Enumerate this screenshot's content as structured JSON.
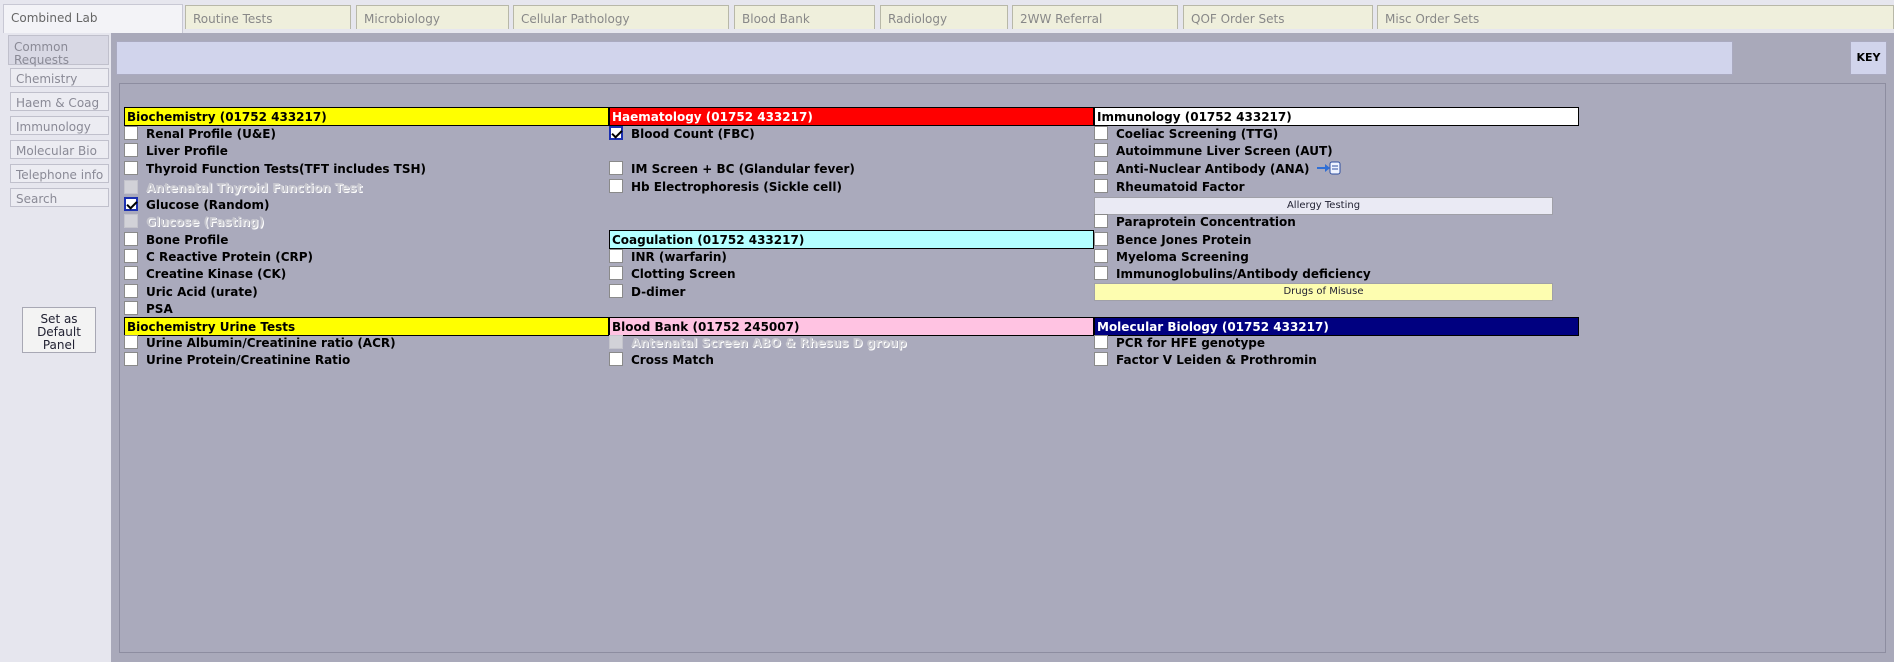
{
  "tabs": [
    "Combined Lab",
    "Routine Tests",
    "Microbiology",
    "Cellular Pathology",
    "Blood Bank",
    "Radiology",
    "2WW Referral",
    "QOF Order Sets",
    "Misc Order Sets"
  ],
  "sidebar": {
    "items": [
      "Common Requests",
      "Chemistry",
      "Haem & Coag",
      "Immunology",
      "Molecular Bio",
      "Telephone info",
      "Search"
    ],
    "set_default_label": "Set as Default Panel"
  },
  "key_label": "KEY",
  "colors": {
    "biochemistry": "#ffff00",
    "haematology": "#ff0000",
    "immunology": "#ffffff",
    "coagulation": "#b3ffff",
    "blood_bank": "#ffc3e2",
    "molecular_biology": "#000080",
    "checkbox_checked_border": "#1b2fb0"
  },
  "sections": {
    "biochemistry": {
      "title": "Biochemistry (01752 433217)",
      "items": [
        {
          "label": "Renal Profile (U&E)",
          "checked": false,
          "disabled": false
        },
        {
          "label": "Liver Profile",
          "checked": false,
          "disabled": false
        },
        {
          "label": "Thyroid Function Tests(TFT includes TSH)",
          "checked": false,
          "disabled": false
        },
        {
          "label": "Antenatal Thyroid Function Test",
          "checked": false,
          "disabled": true
        },
        {
          "label": "Glucose (Random)",
          "checked": true,
          "disabled": false
        },
        {
          "label": "Glucose (Fasting)",
          "checked": false,
          "disabled": true
        },
        {
          "label": "Bone Profile",
          "checked": false,
          "disabled": false
        },
        {
          "label": "C Reactive Protein (CRP)",
          "checked": false,
          "disabled": false
        },
        {
          "label": "Creatine Kinase (CK)",
          "checked": false,
          "disabled": false
        },
        {
          "label": "Uric Acid (urate)",
          "checked": false,
          "disabled": false
        },
        {
          "label": "PSA",
          "checked": false,
          "disabled": false
        }
      ]
    },
    "haematology": {
      "title": "Haematology (01752 433217)",
      "items": [
        {
          "label": "Blood Count (FBC)",
          "checked": true,
          "disabled": false
        },
        {
          "label": "IM Screen + BC (Glandular fever)",
          "checked": false,
          "disabled": false
        },
        {
          "label": "Hb Electrophoresis (Sickle cell)",
          "checked": false,
          "disabled": false
        }
      ]
    },
    "coagulation": {
      "title": "Coagulation (01752 433217)",
      "items": [
        {
          "label": "INR (warfarin)",
          "checked": false,
          "disabled": false
        },
        {
          "label": "Clotting Screen",
          "checked": false,
          "disabled": false
        },
        {
          "label": "D-dimer",
          "checked": false,
          "disabled": false
        }
      ]
    },
    "immunology": {
      "title": "Immunology (01752 433217)",
      "items": [
        {
          "label": "Coeliac Screening (TTG)",
          "checked": false,
          "disabled": false
        },
        {
          "label": "Autoimmune Liver Screen (AUT)",
          "checked": false,
          "disabled": false
        },
        {
          "label": "Anti-Nuclear Antibody (ANA)",
          "checked": false,
          "disabled": false,
          "icon": "info-hand-icon"
        },
        {
          "label": "Rheumatoid Factor",
          "checked": false,
          "disabled": false
        },
        {
          "label": "Paraprotein Concentration",
          "checked": false,
          "disabled": false
        },
        {
          "label": "Bence Jones Protein",
          "checked": false,
          "disabled": false
        },
        {
          "label": "Myeloma Screening",
          "checked": false,
          "disabled": false
        },
        {
          "label": "Immunoglobulins/Antibody deficiency",
          "checked": false,
          "disabled": false
        }
      ],
      "allergy_button": "Allergy Testing",
      "drugs_button": "Drugs of Misuse"
    },
    "biochemistry_urine": {
      "title": "Biochemistry Urine Tests",
      "items": [
        {
          "label": "Urine Albumin/Creatinine ratio (ACR)",
          "checked": false,
          "disabled": false
        },
        {
          "label": "Urine Protein/Creatinine Ratio",
          "checked": false,
          "disabled": false
        }
      ]
    },
    "blood_bank": {
      "title": "Blood Bank (01752 245007)",
      "items": [
        {
          "label": "Antenatal Screen ABO & Rhesus D group",
          "checked": false,
          "disabled": true
        },
        {
          "label": "Cross Match",
          "checked": false,
          "disabled": false
        }
      ]
    },
    "molecular_biology": {
      "title": "Molecular Biology (01752 433217)",
      "items": [
        {
          "label": "PCR for HFE genotype",
          "checked": false,
          "disabled": false
        },
        {
          "label": "Factor V Leiden & Prothromin",
          "checked": false,
          "disabled": false
        }
      ]
    }
  }
}
